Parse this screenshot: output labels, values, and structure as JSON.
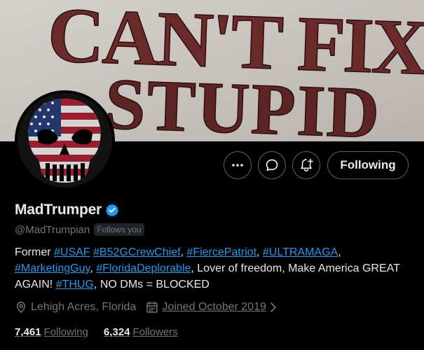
{
  "banner": {
    "sign_line1": "CAN'T FIX",
    "sign_line2": "STUPID"
  },
  "profile": {
    "display_name": "MadTrumper",
    "handle": "@MadTrumpian",
    "follows_you": "Follows you",
    "verified": true
  },
  "actions": {
    "more_icon": "more-icon",
    "message_icon": "message-icon",
    "notify_icon": "notification-bell-icon",
    "follow_label": "Following"
  },
  "bio": {
    "segments": [
      {
        "t": "Former ",
        "link": false
      },
      {
        "t": "#USAF",
        "link": true
      },
      {
        "t": " ",
        "link": false
      },
      {
        "t": "#B52GCrewChief",
        "link": true
      },
      {
        "t": ", ",
        "link": false
      },
      {
        "t": "#FiercePatriot",
        "link": true
      },
      {
        "t": ", ",
        "link": false
      },
      {
        "t": "#ULTRAMAGA",
        "link": true
      },
      {
        "t": ", ",
        "link": false
      },
      {
        "t": "#MarketingGuy",
        "link": true
      },
      {
        "t": ", ",
        "link": false
      },
      {
        "t": "#FloridaDeplorable",
        "link": true
      },
      {
        "t": ", Lover of freedom, Make America GREAT AGAIN! ",
        "link": false
      },
      {
        "t": "#THUG",
        "link": true
      },
      {
        "t": ", NO DMs = BLOCKED",
        "link": false
      }
    ]
  },
  "meta": {
    "location": "Lehigh Acres, Florida",
    "joined": "Joined October 2019"
  },
  "stats": {
    "following_count": "7,461",
    "following_label": "Following",
    "followers_count": "6,324",
    "followers_label": "Followers"
  },
  "colors": {
    "background": "#000000",
    "text": "#e7e9ea",
    "muted": "#71767b",
    "link": "#1d9bf0",
    "border": "#536471",
    "verified": "#1d9bf0",
    "sign": "#6b2a2a"
  }
}
